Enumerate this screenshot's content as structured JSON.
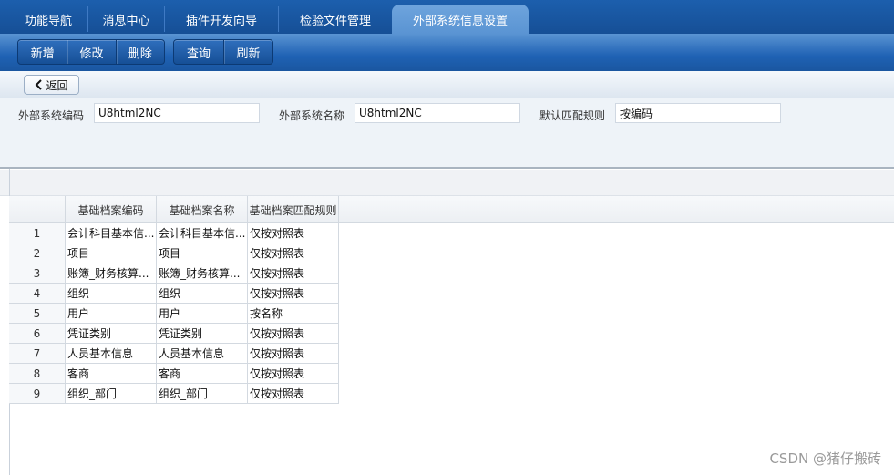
{
  "top_tabs": [
    {
      "label": "功能导航",
      "active": false
    },
    {
      "label": "消息中心",
      "active": false
    },
    {
      "label": "插件开发向导",
      "active": false
    },
    {
      "label": "检验文件管理",
      "active": false
    },
    {
      "label": "外部系统信息设置",
      "active": true
    }
  ],
  "toolbar": {
    "add_label": "新增",
    "edit_label": "修改",
    "delete_label": "删除",
    "query_label": "查询",
    "refresh_label": "刷新"
  },
  "back_label": "返回",
  "form": {
    "code_label": "外部系统编码",
    "code_value": "U8html2NC",
    "name_label": "外部系统名称",
    "name_value": "U8html2NC",
    "rule_label": "默认匹配规则",
    "rule_value": "按编码"
  },
  "grid": {
    "columns": [
      "基础档案编码",
      "基础档案名称",
      "基础档案匹配规则"
    ],
    "rows": [
      {
        "num": "1",
        "code": "会计科目基本信...",
        "name": "会计科目基本信...",
        "rule": "仅按对照表"
      },
      {
        "num": "2",
        "code": "项目",
        "name": "项目",
        "rule": "仅按对照表"
      },
      {
        "num": "3",
        "code": "账簿_财务核算...",
        "name": "账簿_财务核算...",
        "rule": "仅按对照表"
      },
      {
        "num": "4",
        "code": "组织",
        "name": "组织",
        "rule": "仅按对照表"
      },
      {
        "num": "5",
        "code": "用户",
        "name": "用户",
        "rule": "按名称"
      },
      {
        "num": "6",
        "code": "凭证类别",
        "name": "凭证类别",
        "rule": "仅按对照表"
      },
      {
        "num": "7",
        "code": "人员基本信息",
        "name": "人员基本信息",
        "rule": "仅按对照表"
      },
      {
        "num": "8",
        "code": "客商",
        "name": "客商",
        "rule": "仅按对照表"
      },
      {
        "num": "9",
        "code": "组织_部门",
        "name": "组织_部门",
        "rule": "仅按对照表"
      }
    ]
  },
  "watermark": "CSDN @猪仔搬砖",
  "colors": {
    "tab_bar": "#1c5fad",
    "active_tab": "#6ea4dd",
    "toolbar": "#1f62b4",
    "form_bg": "#eef3f8"
  }
}
